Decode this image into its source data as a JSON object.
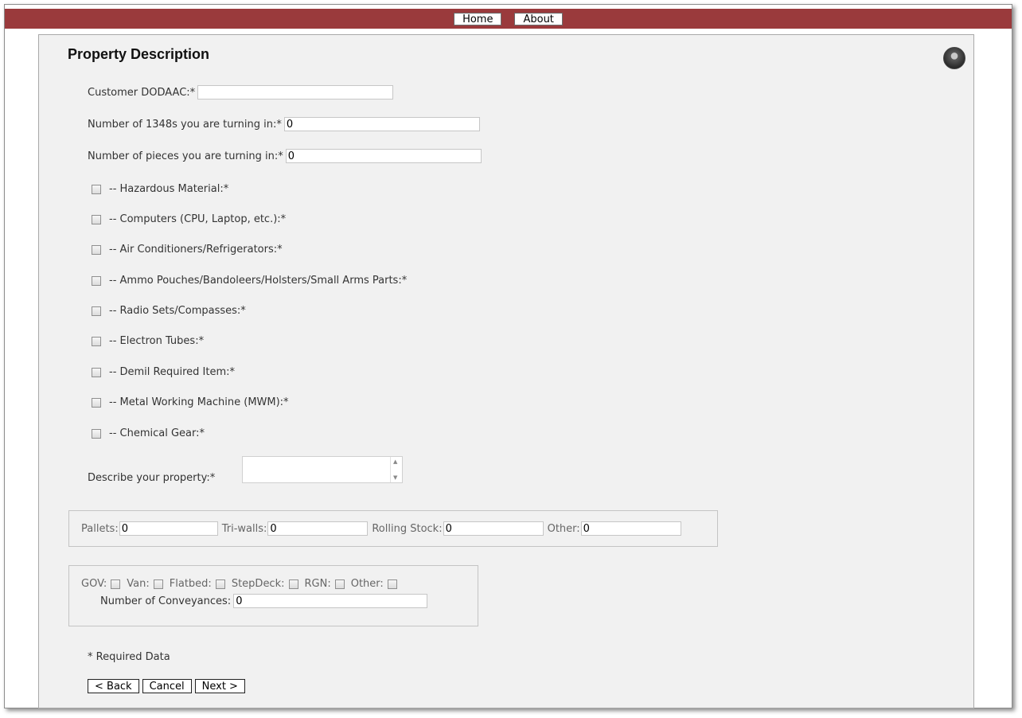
{
  "nav": {
    "home": "Home",
    "about": "About"
  },
  "page": {
    "title": "Property Description"
  },
  "fields": {
    "dodaac_label": "Customer DODAAC:*",
    "dodaac_value": "",
    "num1348_label": "Number of 1348s you are turning in:*",
    "num1348_value": "0",
    "pieces_label": "Number of pieces you are turning in:*",
    "pieces_value": "0"
  },
  "checkboxes": [
    "-- Hazardous Material:*",
    "-- Computers (CPU, Laptop, etc.):*",
    "-- Air Conditioners/Refrigerators:*",
    "-- Ammo Pouches/Bandoleers/Holsters/Small Arms Parts:*",
    "-- Radio Sets/Compasses:*",
    "-- Electron Tubes:*",
    "-- Demil Required Item:*",
    "-- Metal Working Machine (MWM):*",
    "-- Chemical Gear:*"
  ],
  "describe": {
    "label": "Describe your property:*",
    "value": ""
  },
  "containers": {
    "pallets_label": "Pallets:",
    "pallets_value": "0",
    "triwalls_label": "Tri-walls:",
    "triwalls_value": "0",
    "rolling_label": "Rolling Stock:",
    "rolling_value": "0",
    "other_label": "Other:",
    "other_value": "0"
  },
  "vehicles": {
    "gov": "GOV:",
    "van": "Van:",
    "flatbed": "Flatbed:",
    "stepdeck": "StepDeck:",
    "rgn": "RGN:",
    "other": "Other:",
    "conveyances_label": "Number of Conveyances:",
    "conveyances_value": "0"
  },
  "footer": {
    "required_note": "* Required Data",
    "back": "< Back",
    "cancel": "Cancel",
    "next": "Next >"
  },
  "colors": {
    "topbar": "#9a3a3c",
    "panel": "#f1f1f1"
  },
  "icons": {
    "logo": "agency-seal-icon"
  }
}
